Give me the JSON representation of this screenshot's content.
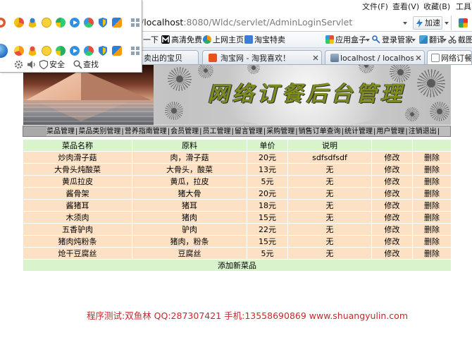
{
  "browser": {
    "menu": [
      "文件(F)",
      "查看(V)",
      "收藏(B)",
      "工具"
    ],
    "address": {
      "prefix": "/",
      "host": "localhost",
      "rest": ":8080/Wldc/servlet/AdminLoginServlet"
    },
    "accelerate_label": "加速",
    "bookmarks": [
      {
        "label": "一下"
      },
      {
        "label": "高清免费",
        "icon": "m-logo-icon"
      },
      {
        "label": "上网主页",
        "icon": "home-page-icon"
      },
      {
        "label": "淘宝特卖",
        "icon": "taobao-icon"
      },
      {
        "label": "应用盒子",
        "icon": "app-box-icon"
      },
      {
        "label": "登录管家",
        "icon": "key-icon"
      },
      {
        "label": "翻译",
        "icon": "translate-icon"
      },
      {
        "label": "截图",
        "icon": "scissors-icon"
      }
    ],
    "tabs": [
      {
        "label": "卖出的宝贝",
        "active": false
      },
      {
        "label": "淘宝网 - 淘我喜欢！",
        "active": false,
        "icon": "taobao-icon"
      },
      {
        "label": "localhost / localhost /...",
        "active": false,
        "icon": "page-icon"
      },
      {
        "label": "网络订餐后",
        "active": true,
        "icon": "page-icon"
      }
    ]
  },
  "toolbar_popup": {
    "security_label": "安全",
    "find_label": "查找"
  },
  "banner": {
    "title": "网络订餐后台管理"
  },
  "nav": {
    "separator": "|",
    "items": [
      "菜品管理",
      "菜品类别管理",
      "营养指南管理",
      "会员管理",
      "员工管理",
      "留言管理",
      "采购管理",
      "销售订单查询",
      "统计管理",
      "用户管理",
      "注销退出"
    ]
  },
  "table": {
    "headers": [
      "菜品名称",
      "原料",
      "单价",
      "说明",
      "",
      ""
    ],
    "edit_label": "修改",
    "delete_label": "删除",
    "rows": [
      {
        "name": "炒肉滑子菇",
        "ingredients": "肉，滑子菇",
        "price": "20元",
        "note": "sdfsdfsdf"
      },
      {
        "name": "大骨头炖酸菜",
        "ingredients": "大骨头，酸菜",
        "price": "13元",
        "note": "无"
      },
      {
        "name": "黄瓜拉皮",
        "ingredients": "黄瓜，拉皮",
        "price": "5元",
        "note": "无"
      },
      {
        "name": "酱骨架",
        "ingredients": "猪大骨",
        "price": "20元",
        "note": "无"
      },
      {
        "name": "酱猪耳",
        "ingredients": "猪耳",
        "price": "18元",
        "note": "无"
      },
      {
        "name": "木须肉",
        "ingredients": "猪肉",
        "price": "15元",
        "note": "无"
      },
      {
        "name": "五香驴肉",
        "ingredients": "驴肉",
        "price": "22元",
        "note": "无"
      },
      {
        "name": "猪肉炖粉条",
        "ingredients": "猪肉，粉条",
        "price": "15元",
        "note": "无"
      },
      {
        "name": "炝干豆腐丝",
        "ingredients": "豆腐丝",
        "price": "5元",
        "note": "无"
      }
    ],
    "add_label": "添加新菜品"
  },
  "footer": {
    "text": "程序测试:双鱼林 QQ:287307421 手机:13558690869 www.shuangyulin.com"
  },
  "colors": {
    "table_header_bg": "#d9f3cd",
    "table_row_bg": "#fde1c5",
    "nav_bg": "#bdbdbd",
    "banner_title": "#7d8c1c",
    "footer_text": "#c8282d"
  }
}
